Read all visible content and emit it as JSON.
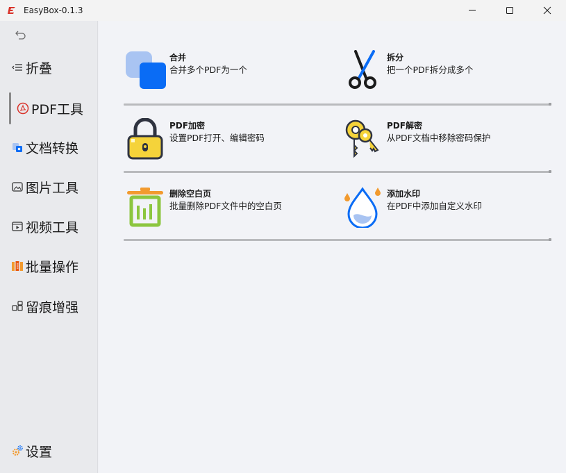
{
  "window": {
    "title": "EasyBox-0.1.3",
    "controls": {
      "minimize": "minimize",
      "maximize": "maximize",
      "close": "close"
    }
  },
  "sidebar": {
    "back_icon": "back-arrow-icon",
    "items": [
      {
        "label": "折叠",
        "icon": "collapse-icon"
      },
      {
        "label": "PDF工具",
        "icon": "pdf-icon",
        "active": true
      },
      {
        "label": "文档转换",
        "icon": "document-convert-icon"
      },
      {
        "label": "图片工具",
        "icon": "image-icon"
      },
      {
        "label": "视频工具",
        "icon": "video-icon"
      },
      {
        "label": "批量操作",
        "icon": "batch-icon"
      },
      {
        "label": "留痕增强",
        "icon": "trace-enhance-icon"
      }
    ],
    "settings": {
      "label": "设置",
      "icon": "settings-icon"
    }
  },
  "tools": [
    {
      "title": "合并",
      "desc": "合并多个PDF为一个",
      "icon": "merge-icon"
    },
    {
      "title": "拆分",
      "desc": "把一个PDF拆分成多个",
      "icon": "scissors-icon"
    },
    {
      "title": "PDF加密",
      "desc": "设置PDF打开、编辑密码",
      "icon": "lock-icon"
    },
    {
      "title": "PDF解密",
      "desc": "从PDF文档中移除密码保护",
      "icon": "keys-icon"
    },
    {
      "title": "删除空白页",
      "desc": "批量删除PDF文件中的空白页",
      "icon": "trash-icon"
    },
    {
      "title": "添加水印",
      "desc": "在PDF中添加自定义水印",
      "icon": "water-drop-icon"
    }
  ],
  "colors": {
    "accent_blue": "#0a6cf5",
    "light_blue": "#a9c4f2",
    "lock_yellow": "#f5d33a",
    "trash_green": "#8cc63f",
    "trash_orange": "#f29a2e",
    "pdf_red": "#d9342b"
  }
}
